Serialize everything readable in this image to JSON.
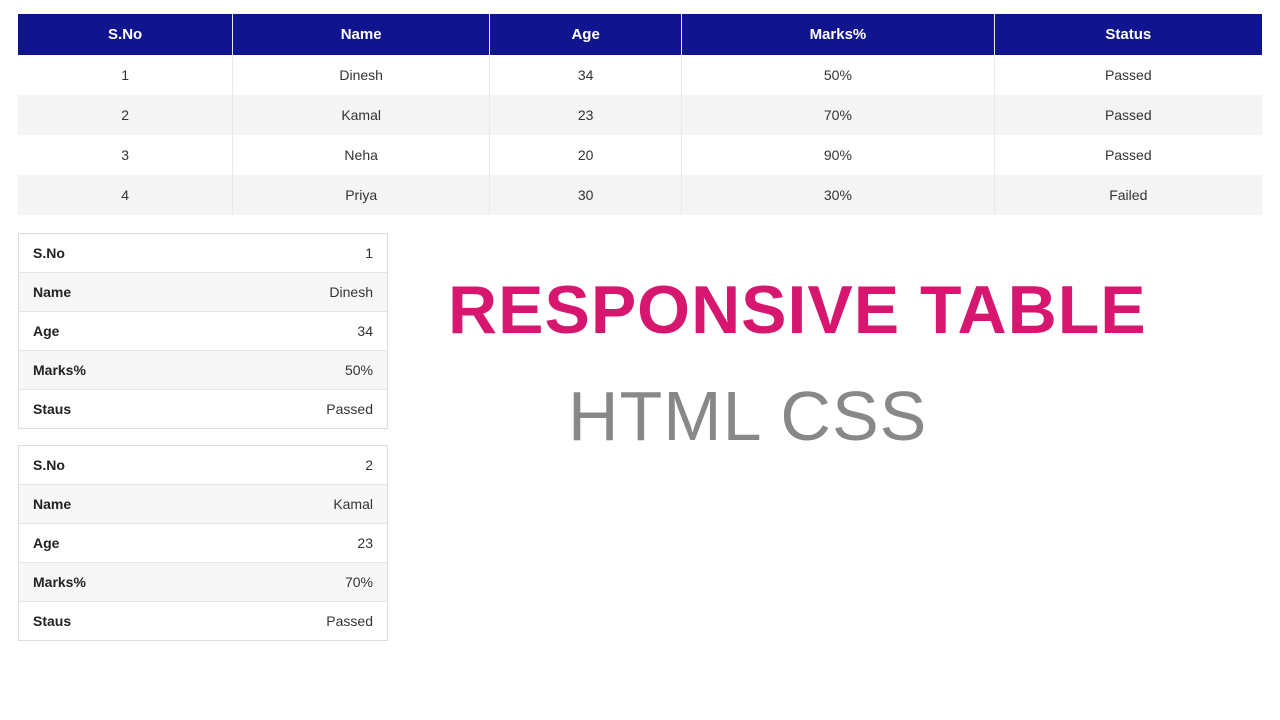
{
  "table": {
    "headers": [
      "S.No",
      "Name",
      "Age",
      "Marks%",
      "Status"
    ],
    "rows": [
      {
        "sno": "1",
        "name": "Dinesh",
        "age": "34",
        "marks": "50%",
        "status": "Passed"
      },
      {
        "sno": "2",
        "name": "Kamal",
        "age": "23",
        "marks": "70%",
        "status": "Passed"
      },
      {
        "sno": "3",
        "name": "Neha",
        "age": "20",
        "marks": "90%",
        "status": "Passed"
      },
      {
        "sno": "4",
        "name": "Priya",
        "age": "30",
        "marks": "30%",
        "status": "Failed"
      }
    ]
  },
  "cards": [
    {
      "fields": [
        {
          "label": "S.No",
          "value": "1"
        },
        {
          "label": "Name",
          "value": "Dinesh"
        },
        {
          "label": "Age",
          "value": "34"
        },
        {
          "label": "Marks%",
          "value": "50%"
        },
        {
          "label": "Staus",
          "value": "Passed"
        }
      ]
    },
    {
      "fields": [
        {
          "label": "S.No",
          "value": "2"
        },
        {
          "label": "Name",
          "value": "Kamal"
        },
        {
          "label": "Age",
          "value": "23"
        },
        {
          "label": "Marks%",
          "value": "70%"
        },
        {
          "label": "Staus",
          "value": "Passed"
        }
      ]
    }
  ],
  "title": {
    "line1": "RESPONSIVE TABLE",
    "line2": "HTML CSS"
  }
}
